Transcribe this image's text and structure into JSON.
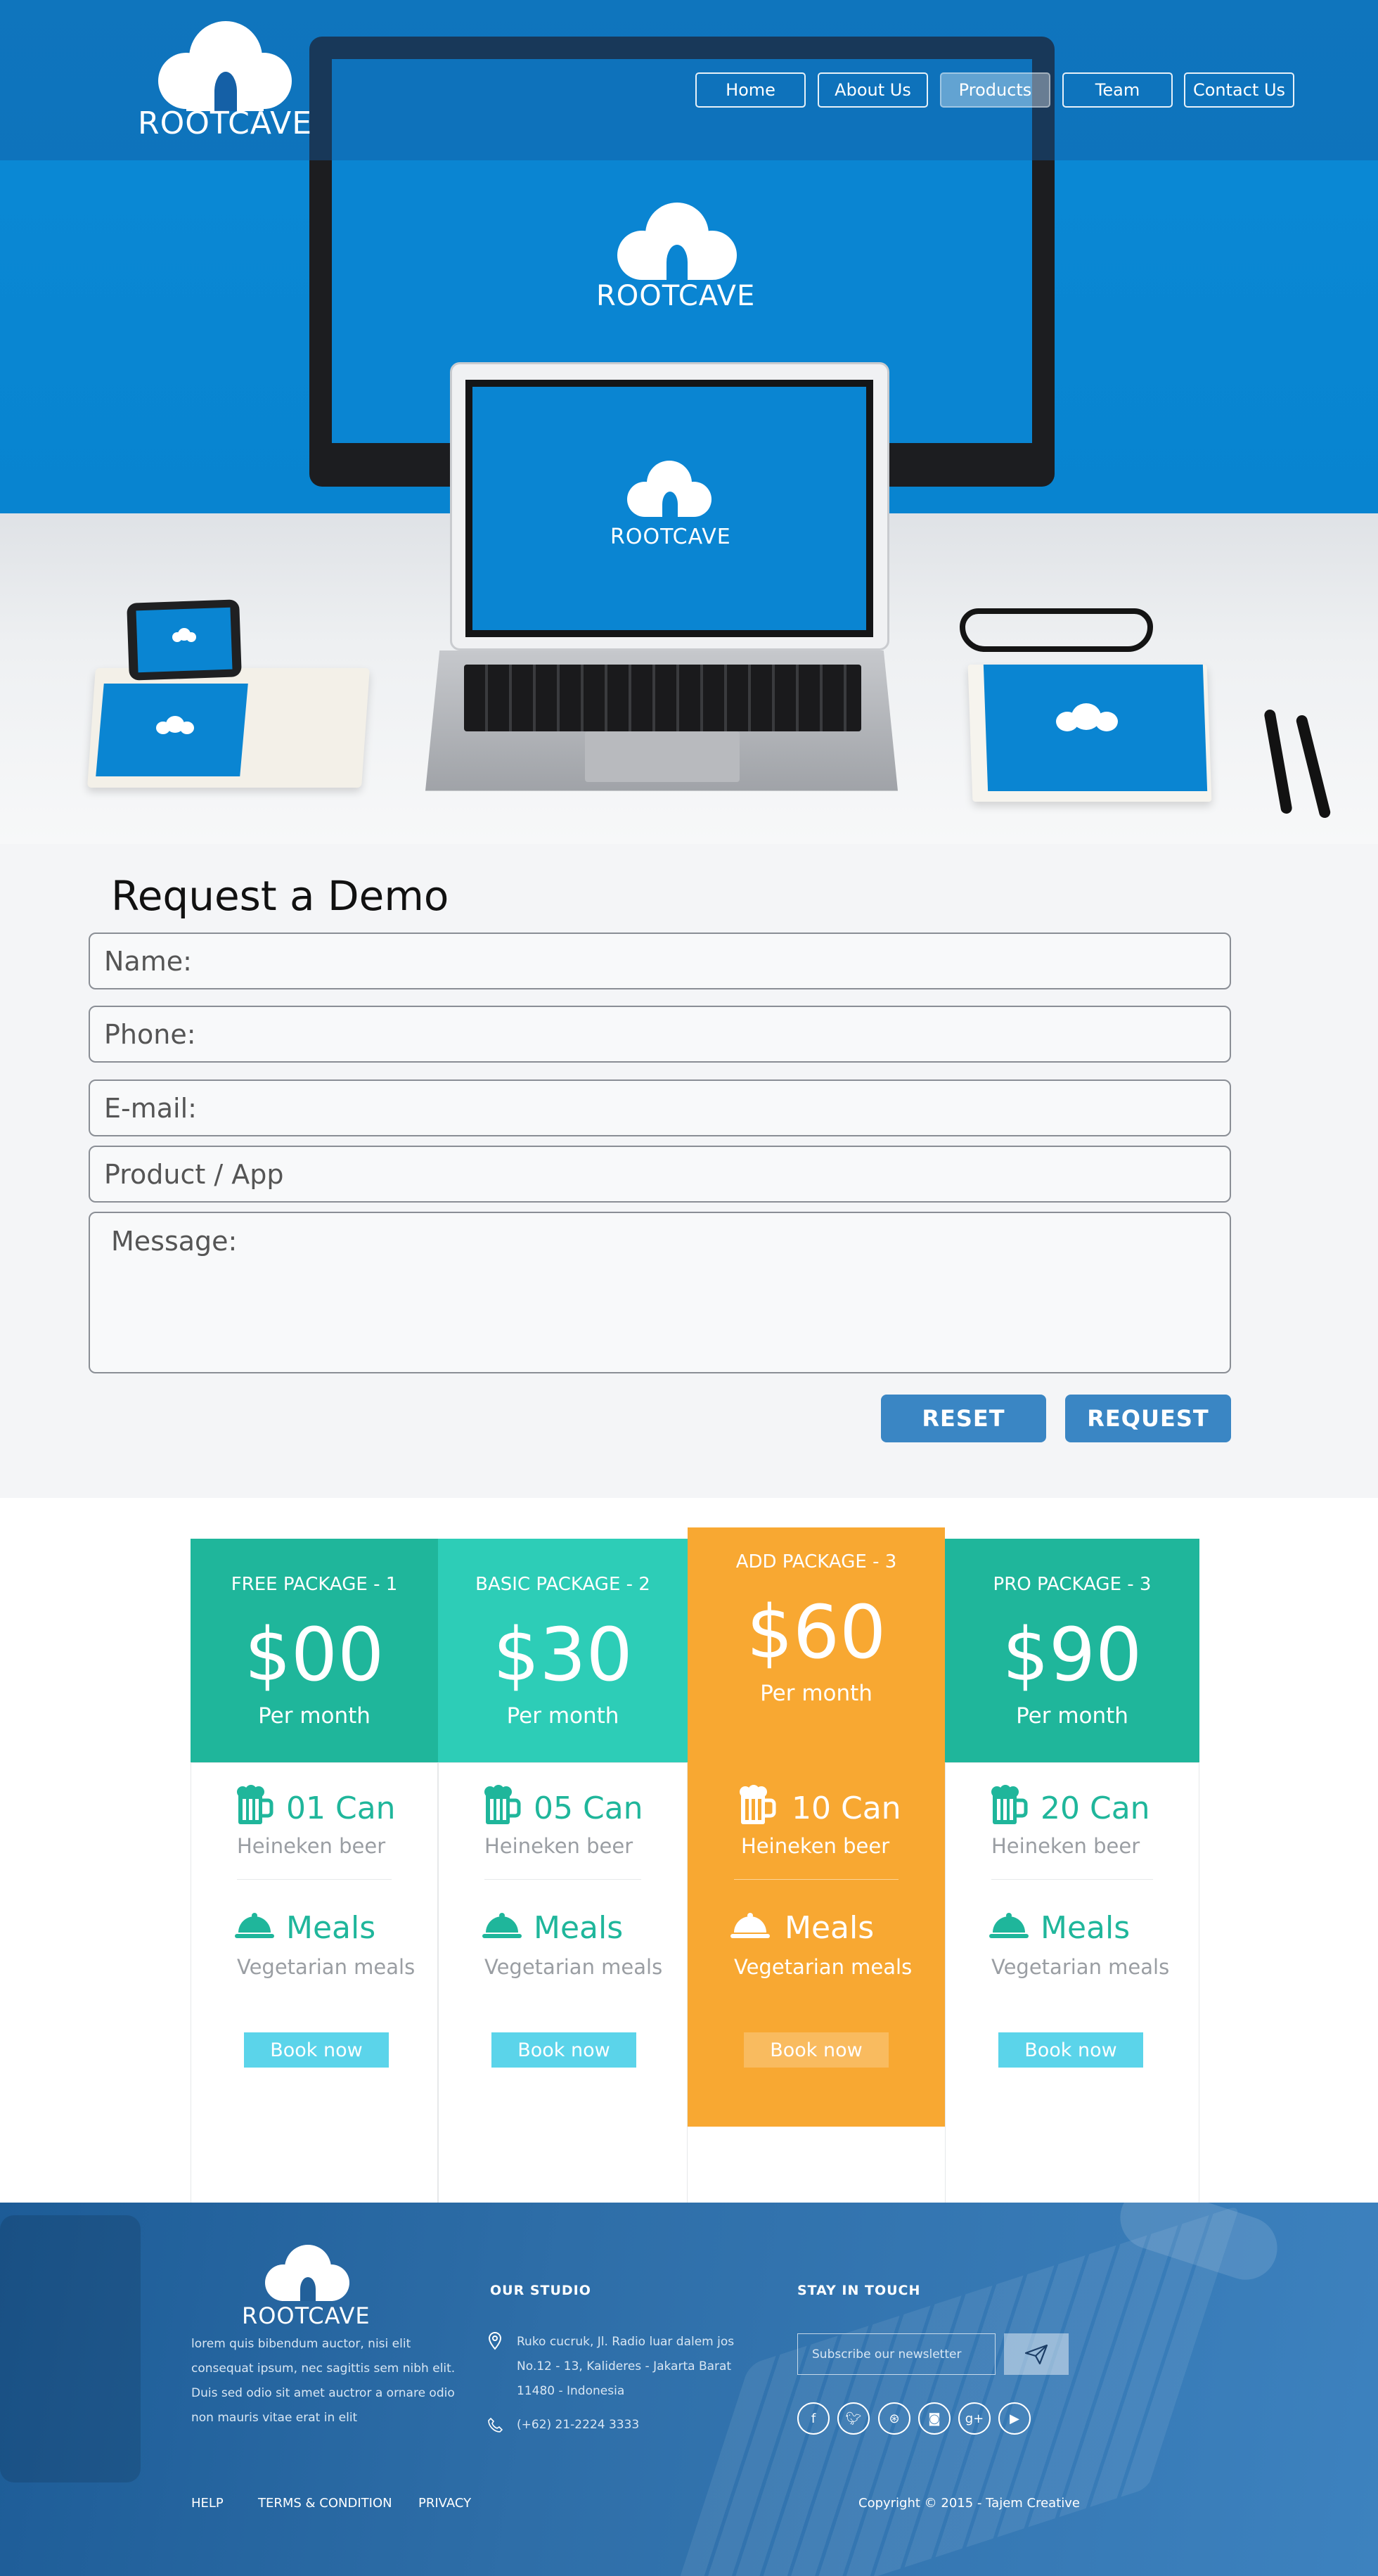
{
  "brand": {
    "name": "ROOTCAVE"
  },
  "nav": {
    "items": [
      "Home",
      "About Us",
      "Products",
      "Team",
      "Contact Us"
    ],
    "active": "Products"
  },
  "form": {
    "title": "Request a Demo",
    "name_placeholder": "Name:",
    "phone_placeholder": "Phone:",
    "email_placeholder": "E-mail:",
    "product_placeholder": "Product / App",
    "message_placeholder": "Message:",
    "reset_label": "RESET",
    "request_label": "REQUEST"
  },
  "pricing": {
    "packages": [
      {
        "title": "FREE PACKAGE - 1",
        "price": "$00",
        "period": "Per month",
        "beer_count": "01",
        "beer_unit": "Can",
        "beer_label": "Heineken beer",
        "meals_label": "Meals",
        "meals_sub": "Vegetarian meals",
        "button": "Book now",
        "head_color": "#1fb69b",
        "accent_color": "#1fb69b"
      },
      {
        "title": "BASIC PACKAGE - 2",
        "price": "$30",
        "period": "Per month",
        "beer_count": "05",
        "beer_unit": "Can",
        "beer_label": "Heineken beer",
        "meals_label": "Meals",
        "meals_sub": "Vegetarian meals",
        "button": "Book now",
        "head_color": "#2dcdb7",
        "accent_color": "#1fb69b"
      },
      {
        "title": "ADD PACKAGE - 3",
        "price": "$60",
        "period": "Per month",
        "beer_count": "10",
        "beer_unit": "Can",
        "beer_label": "Heineken beer",
        "meals_label": "Meals",
        "meals_sub": "Vegetarian meals",
        "button": "Book now",
        "head_color": "#f8a832",
        "accent_color": "#ffffff"
      },
      {
        "title": "PRO PACKAGE - 3",
        "price": "$90",
        "period": "Per month",
        "beer_count": "20",
        "beer_unit": "Can",
        "beer_label": "Heineken beer",
        "meals_label": "Meals",
        "meals_sub": "Vegetarian meals",
        "button": "Book now",
        "head_color": "#1fb69b",
        "accent_color": "#1fb69b"
      }
    ],
    "book_button_color": "#5bd4ea"
  },
  "footer": {
    "brand": "ROOTCAVE",
    "about_lines": [
      "lorem quis bibendum auctor, nisi elit",
      "consequat ipsum, nec sagittis sem nibh elit.",
      "Duis sed odio sit amet auctror a ornare odio",
      "non mauris vitae erat in elit"
    ],
    "studio_heading": "OUR STUDIO",
    "address_lines": [
      "Ruko cucruk, Jl. Radio luar dalem jos",
      "No.12 - 13, Kalideres - Jakarta Barat",
      "11480 - Indonesia"
    ],
    "phone": "(+62) 21-2224 3333",
    "touch_heading": "STAY IN TOUCH",
    "newsletter_placeholder": "Subscribe our newsletter",
    "social_icons": [
      "facebook-icon",
      "twitter-icon",
      "dribbble-icon",
      "instagram-icon",
      "google-plus-icon",
      "youtube-icon"
    ],
    "links": [
      "HELP",
      "TERMS & CONDITION",
      "PRIVACY"
    ],
    "copyright": "Copyright © 2015 - Tajem Creative"
  }
}
